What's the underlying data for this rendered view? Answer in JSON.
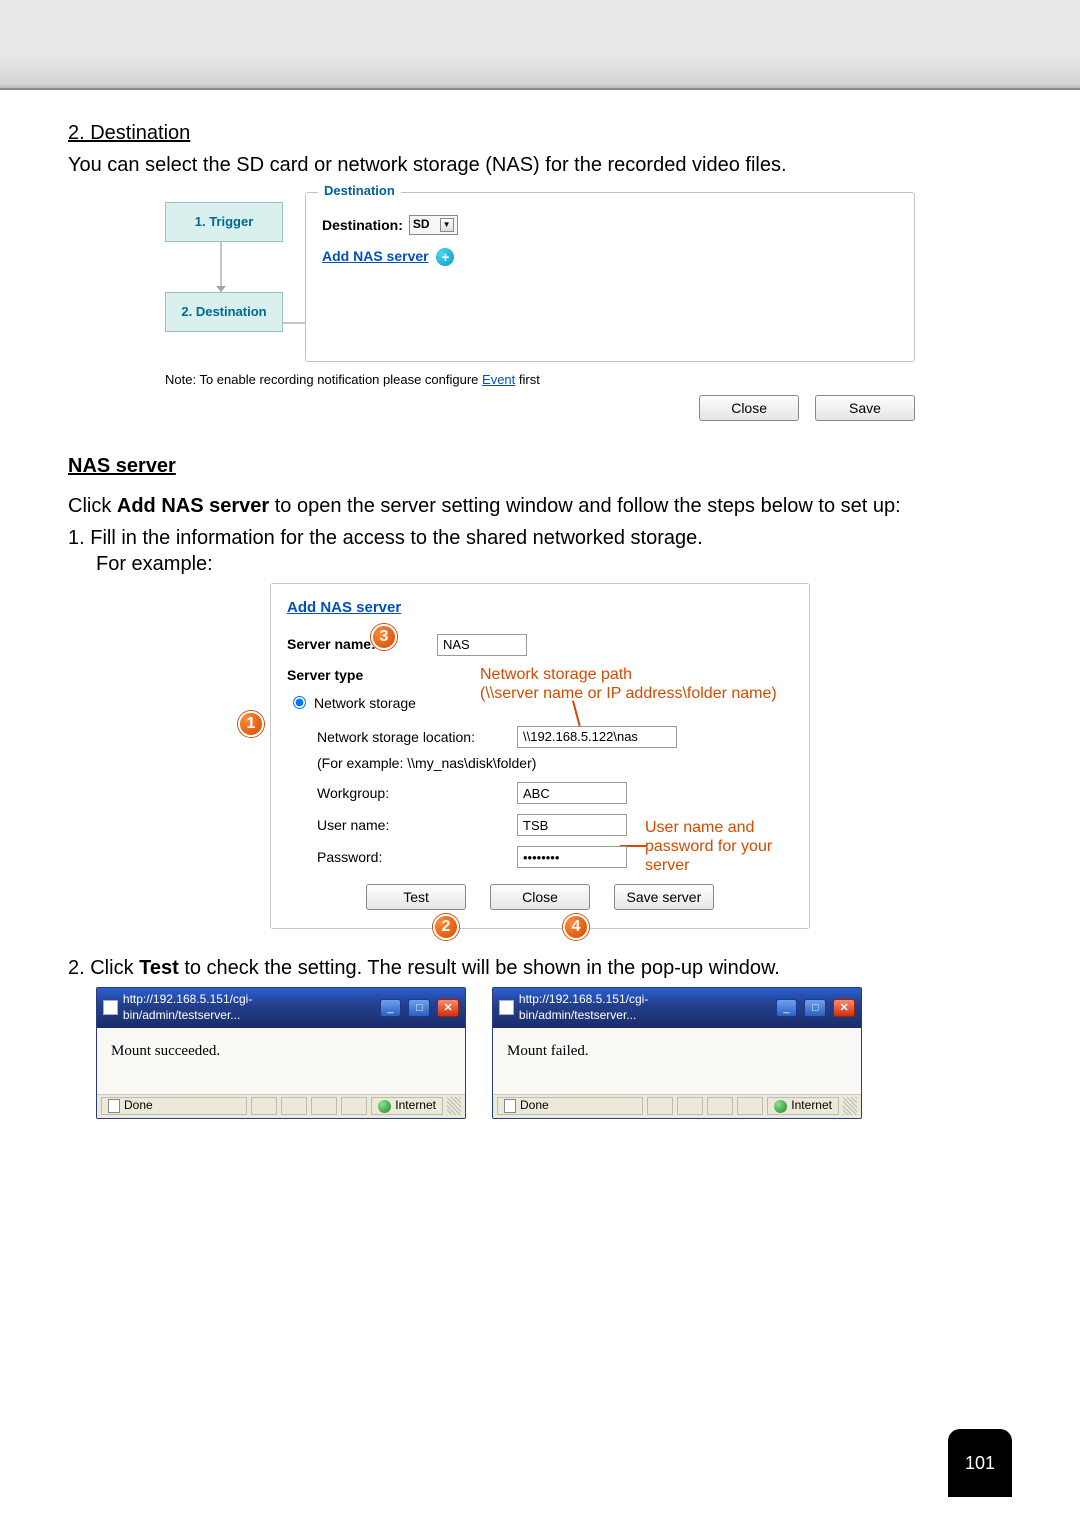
{
  "section_title": "2. Destination",
  "intro_text": "You can select the SD card or network storage (NAS) for the recorded video files.",
  "fig1": {
    "step1": "1.  Trigger",
    "step2": "2.  Destination",
    "legend": "Destination",
    "dest_label": "Destination:",
    "dest_value": "SD",
    "add_nas": "Add NAS server",
    "note_prefix": "Note: To enable recording notification please configure ",
    "note_link": "Event",
    "note_suffix": " first",
    "close": "Close",
    "save": "Save"
  },
  "nas_heading": "NAS server",
  "nas_intro_prefix": "Click ",
  "nas_intro_bold": "Add NAS server",
  "nas_intro_suffix": " to open the server setting window and follow the steps below to set up:",
  "nas_step1": "1. Fill in the information for the access to the shared networked storage.",
  "nas_example": "For example:",
  "fig2": {
    "title": "Add NAS server",
    "server_name_lbl": "Server name:",
    "server_name_val": "NAS",
    "server_type_lbl": "Server type",
    "radio_net": "Network storage",
    "loc_lbl": "Network storage location:",
    "loc_val": "\\\\192.168.5.122\\nas",
    "loc_example": "(For example: \\\\my_nas\\disk\\folder)",
    "workgroup_lbl": "Workgroup:",
    "workgroup_val": "ABC",
    "user_lbl": "User name:",
    "user_val": "TSB",
    "pass_lbl": "Password:",
    "pass_val": "••••••••",
    "btn_test": "Test",
    "btn_close": "Close",
    "btn_save": "Save server",
    "callout_path_line1": "Network storage path",
    "callout_path_line2": "(\\\\server name or IP address\\folder name)",
    "callout_cred": "User name and password for your server",
    "bubble1": "1",
    "bubble2": "2",
    "bubble3": "3",
    "bubble4": "4"
  },
  "test_instruction_prefix": "2. Click ",
  "test_instruction_bold": "Test",
  "test_instruction_suffix": " to check the setting. The result will be shown in the pop-up window.",
  "popup": {
    "url": "http://192.168.5.151/cgi-bin/admin/testserver...",
    "msg_ok": "Mount succeeded.",
    "msg_fail": "Mount failed.",
    "done": "Done",
    "internet": "Internet"
  },
  "pagenum": "101"
}
